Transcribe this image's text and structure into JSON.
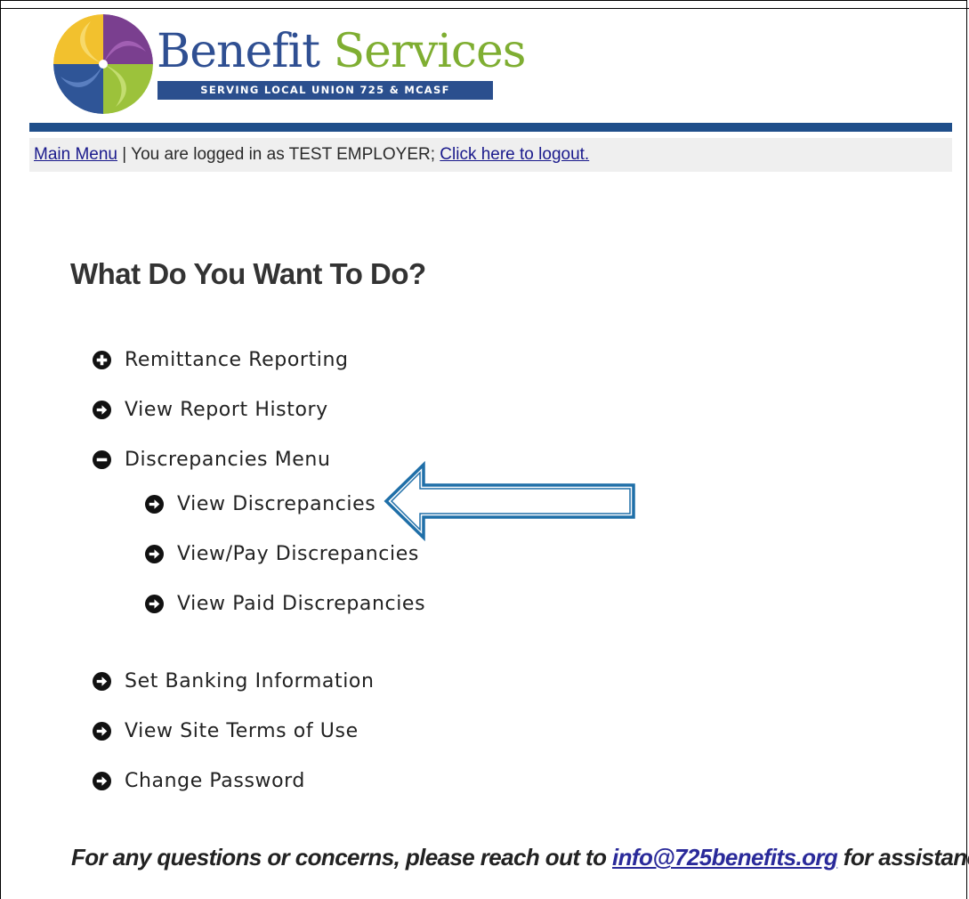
{
  "logo": {
    "title_word1": "Benefit",
    "title_word2": "Services",
    "subtitle": "SERVING LOCAL UNION 725 & MCASF"
  },
  "nav": {
    "main_menu_link": "Main Menu",
    "separator": " | ",
    "logged_in_text": "You are logged in as TEST EMPLOYER; ",
    "logout_link": "Click here to logout."
  },
  "page": {
    "heading": "What Do You Want To Do?"
  },
  "menu": {
    "remittance_reporting": {
      "label": "Remittance Reporting",
      "icon": "plus-circle-icon"
    },
    "view_report_history": {
      "label": "View Report History",
      "icon": "arrow-circle-right-icon"
    },
    "discrepancies_menu": {
      "label": "Discrepancies Menu",
      "icon": "minus-circle-icon"
    },
    "view_discrepancies": {
      "label": "View Discrepancies",
      "icon": "arrow-circle-right-icon"
    },
    "view_pay_discrepancies": {
      "label": "View/Pay Discrepancies",
      "icon": "arrow-circle-right-icon"
    },
    "view_paid_discrepancies": {
      "label": "View Paid Discrepancies",
      "icon": "arrow-circle-right-icon"
    },
    "set_banking_information": {
      "label": "Set Banking Information",
      "icon": "arrow-circle-right-icon"
    },
    "view_site_terms": {
      "label": "View Site Terms of Use",
      "icon": "arrow-circle-right-icon"
    },
    "change_password": {
      "label": "Change Password",
      "icon": "arrow-circle-right-icon"
    }
  },
  "footer": {
    "text_before": "For any questions or concerns, please reach out to ",
    "email_link": "info@725benefits.org",
    "text_after": " for assistance."
  },
  "colors": {
    "brand_blue": "#2b4f8e",
    "brand_green": "#7fae32",
    "link_blue": "#1a1a8c",
    "callout_arrow": "#1f6fa8"
  }
}
